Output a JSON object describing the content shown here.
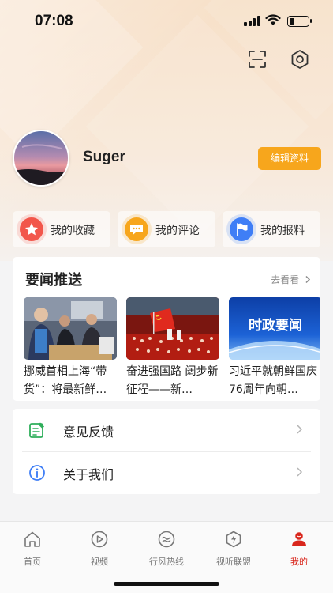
{
  "status_bar": {
    "time": "07:08"
  },
  "profile": {
    "username": "Suger",
    "edit_label": "编辑资料"
  },
  "quick_actions": [
    {
      "label": "我的收藏",
      "icon": "star-icon",
      "color": "#f2564b"
    },
    {
      "label": "我的评论",
      "icon": "comment-icon",
      "color": "#f7a61c"
    },
    {
      "label": "我的报料",
      "icon": "flag-icon",
      "color": "#3f7ef6"
    }
  ],
  "news": {
    "title": "要闻推送",
    "more_label": "去看看",
    "items": [
      {
        "text": "挪威首相上海“带货”：将最新鲜…"
      },
      {
        "text": "奋进强国路 阔步新征程——新…"
      },
      {
        "text": "习近平就朝鲜国庆76周年向朝…",
        "image_caption": "时政要闻"
      }
    ]
  },
  "menu": [
    {
      "label": "意见反馈",
      "icon": "feedback-icon"
    },
    {
      "label": "关于我们",
      "icon": "info-icon"
    }
  ],
  "tabbar": [
    {
      "label": "首页",
      "icon": "home-icon",
      "active": false
    },
    {
      "label": "视频",
      "icon": "video-icon",
      "active": false
    },
    {
      "label": "行风热线",
      "icon": "hotline-icon",
      "active": false
    },
    {
      "label": "视听联盟",
      "icon": "alliance-icon",
      "active": false
    },
    {
      "label": "我的",
      "icon": "profile-icon",
      "active": true
    }
  ],
  "colors": {
    "accent": "#f7a61c",
    "active_tab": "#d9261c"
  }
}
